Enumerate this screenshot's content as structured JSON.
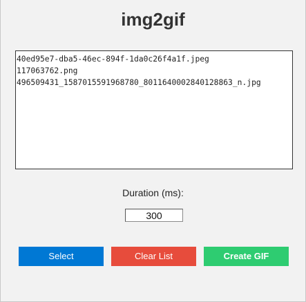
{
  "app": {
    "title": "img2gif"
  },
  "file_list": {
    "items": [
      "40ed95e7-dba5-46ec-894f-1da0c26f4a1f.jpeg",
      "117063762.png",
      "496509431_1587015591968780_8011640002840128863_n.jpg"
    ]
  },
  "duration": {
    "label": "Duration (ms):",
    "value": "300"
  },
  "buttons": {
    "select_label": "Select",
    "clear_label": "Clear List",
    "create_label": "Create GIF"
  },
  "colors": {
    "select": "#0078d4",
    "clear": "#e74c3c",
    "create": "#2ecc71"
  }
}
